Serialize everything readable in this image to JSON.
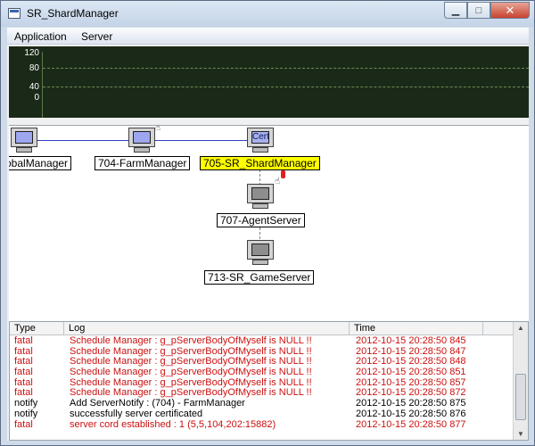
{
  "window": {
    "title": "SR_ShardManager",
    "controls": {
      "minimize": "▁",
      "maximize": "□",
      "close": "✕"
    }
  },
  "menubar": {
    "items": [
      {
        "label": "Application"
      },
      {
        "label": "Server"
      }
    ]
  },
  "graph": {
    "y_labels": [
      "120",
      "80",
      "40",
      "0"
    ],
    "colors": {
      "background": "#1b2a18",
      "gridline": "#6c8a53"
    }
  },
  "topology": {
    "nodes": [
      {
        "label": "obalManager",
        "icon": "monitor-icon",
        "selected": false
      },
      {
        "label": "704-FarmManager",
        "icon": "monitor-icon",
        "selected": false
      },
      {
        "label": "705-SR_ShardManager",
        "icon": "cert-monitor-icon",
        "screen_text": "Cert",
        "selected": true
      },
      {
        "label": "707-AgentServer",
        "icon": "monitor-icon",
        "selected": false
      },
      {
        "label": "713-SR_GameServer",
        "icon": "monitor-icon",
        "selected": false
      }
    ],
    "colors": {
      "selected_label": "#ffff00",
      "link": "#3040c0"
    }
  },
  "log": {
    "columns": [
      "Type",
      "Log",
      "Time"
    ],
    "rows": [
      {
        "type": "fatal",
        "log": "Schedule Manager : g_pServerBodyOfMyself is NULL !!",
        "time": "2012-10-15 20:28:50 845"
      },
      {
        "type": "fatal",
        "log": "Schedule Manager : g_pServerBodyOfMyself is NULL !!",
        "time": "2012-10-15 20:28:50 847"
      },
      {
        "type": "fatal",
        "log": "Schedule Manager : g_pServerBodyOfMyself is NULL !!",
        "time": "2012-10-15 20:28:50 848"
      },
      {
        "type": "fatal",
        "log": "Schedule Manager : g_pServerBodyOfMyself is NULL !!",
        "time": "2012-10-15 20:28:50 851"
      },
      {
        "type": "fatal",
        "log": "Schedule Manager : g_pServerBodyOfMyself is NULL !!",
        "time": "2012-10-15 20:28:50 857"
      },
      {
        "type": "fatal",
        "log": "Schedule Manager : g_pServerBodyOfMyself is NULL !!",
        "time": "2012-10-15 20:28:50 872"
      },
      {
        "type": "notify",
        "log": "Add ServerNotify : (704) - FarmManager",
        "time": "2012-10-15 20:28:50 875"
      },
      {
        "type": "notify",
        "log": "successfully server certificated",
        "time": "2012-10-15 20:28:50 876"
      },
      {
        "type": "fatal",
        "log": "server cord established : 1 (5,5,104,202:15882)",
        "time": "2012-10-15 20:28:50 877"
      }
    ],
    "colors": {
      "fatal": "#cc1010",
      "notify": "#000000"
    }
  }
}
